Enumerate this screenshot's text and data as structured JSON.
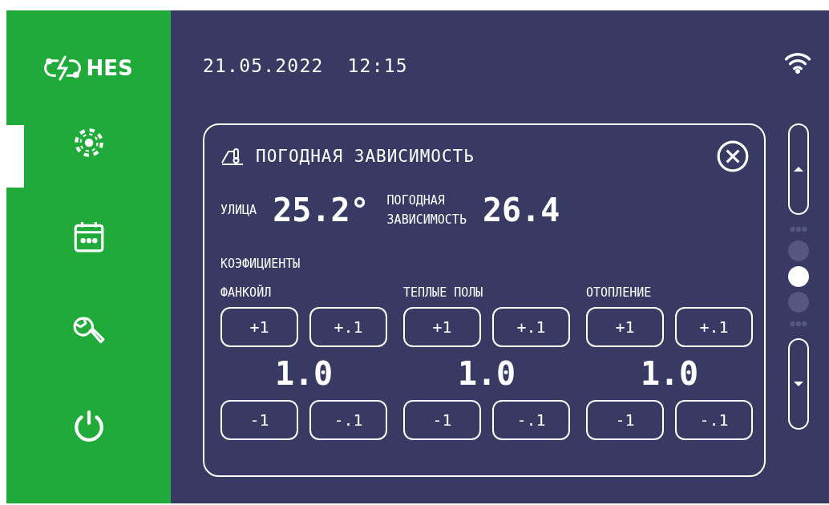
{
  "brand": "HES",
  "header": {
    "datetime": "21.05.2022  12:15"
  },
  "sidebar": {
    "items": [
      {
        "kind": "climate",
        "selected": true
      },
      {
        "kind": "calendar",
        "selected": false
      },
      {
        "kind": "tools",
        "selected": false
      },
      {
        "kind": "power",
        "selected": false
      }
    ]
  },
  "panel": {
    "title": "ПОГОДНАЯ ЗАВИСИМОСТЬ",
    "outdoor": {
      "label": "УЛИЦА",
      "value": "25.2°"
    },
    "curve": {
      "label_1": "ПОГОДНАЯ",
      "label_2": "ЗАВИСИМОСТЬ",
      "value": "26.4"
    },
    "section": "КОЭФИЦИЕНТЫ",
    "groups": [
      {
        "title": "ФАНКОЙЛ",
        "up": [
          "+1",
          "+.1"
        ],
        "value": "1.0",
        "down": [
          "-1",
          "-.1"
        ]
      },
      {
        "title": "ТЕПЛЫЕ ПОЛЫ",
        "up": [
          "+1",
          "+.1"
        ],
        "value": "1.0",
        "down": [
          "-1",
          "-.1"
        ]
      },
      {
        "title": "ОТОПЛЕНИЕ",
        "up": [
          "+1",
          "+.1"
        ],
        "value": "1.0",
        "down": [
          "-1",
          "-.1"
        ]
      }
    ]
  },
  "pages": [
    {
      "selected": false
    },
    {
      "selected": true
    },
    {
      "selected": false
    }
  ]
}
